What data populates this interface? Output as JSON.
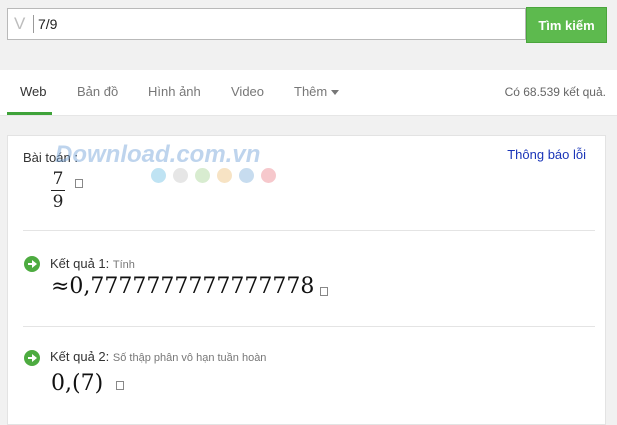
{
  "search": {
    "logo": "V",
    "query": "7/9",
    "button_label": "Tìm kiếm"
  },
  "tabs": [
    {
      "label": "Web",
      "active": true
    },
    {
      "label": "Bản đồ",
      "active": false
    },
    {
      "label": "Hình ảnh",
      "active": false
    },
    {
      "label": "Video",
      "active": false
    },
    {
      "label": "Thêm",
      "active": false
    }
  ],
  "result_count": "Có 68.539 kết quả.",
  "card": {
    "report_link": "Thông báo lỗi",
    "problem_label": "Bài toán :",
    "numerator": "7",
    "denominator": "9",
    "result1_label": "Kết quả 1:",
    "result1_sub": "Tính",
    "result1_value": "≈0,7777777777777778",
    "result2_label": "Kết quả 2:",
    "result2_sub": "Số thập phân vô hạn tuần hoàn",
    "result2_value": "0,(7)"
  },
  "watermark": "Download.com.vn",
  "dot_colors": [
    "#bfe3f3",
    "#e6e6e6",
    "#d8ecd0",
    "#f7e3c4",
    "#c7dcef",
    "#f6c8cc"
  ],
  "accent_color": "#5dba4e"
}
